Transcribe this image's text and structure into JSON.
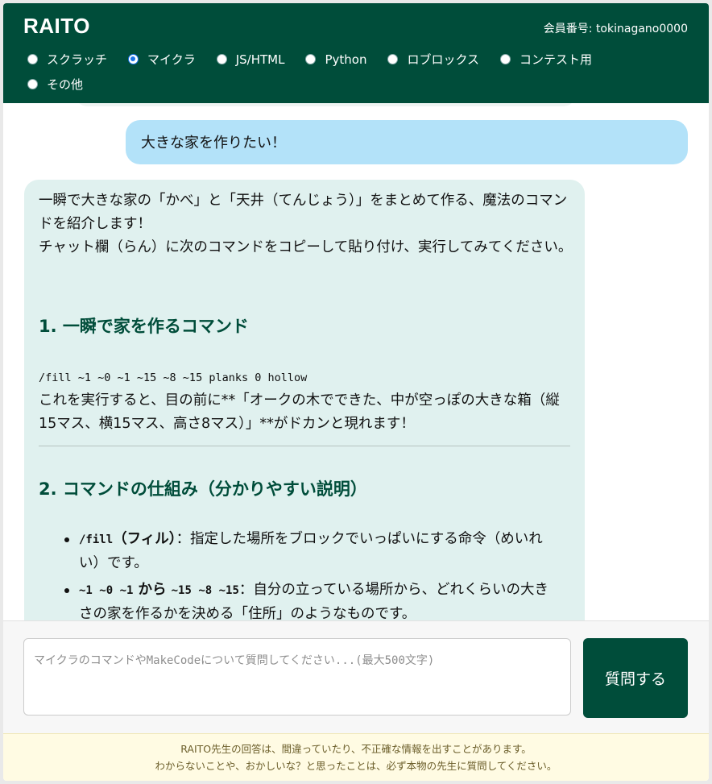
{
  "header": {
    "brand": "RAITO",
    "member_label": "会員番号: tokinagano0000",
    "categories": [
      {
        "label": "スクラッチ",
        "checked": false
      },
      {
        "label": "マイクラ",
        "checked": true
      },
      {
        "label": "JS/HTML",
        "checked": false
      },
      {
        "label": "Python",
        "checked": false
      },
      {
        "label": "ロブロックス",
        "checked": false
      },
      {
        "label": "コンテスト用",
        "checked": false
      },
      {
        "label": "その他",
        "checked": false
      }
    ]
  },
  "chat": {
    "user_message": "大きな家を作りたい！",
    "bot": {
      "intro": "一瞬で大きな家の「かべ」と「天井（てんじょう）」をまとめて作る、魔法のコマンドを紹介します！",
      "instruction": "チャット欄（らん）に次のコマンドをコピーして貼り付け、実行してみてください。",
      "heading1": "1. 一瞬で家を作るコマンド",
      "command": "/fill ~1 ~0 ~1 ~15 ~8 ~15 planks 0 hollow",
      "result": "これを実行すると、目の前に**「オークの木でできた、中が空っぽの大きな箱（縦15マス、横15マス、高さ8マス）」**がドカンと現れます！",
      "heading2": "2. コマンドの仕組み（分かりやすい説明）",
      "bullets": [
        {
          "code": "/fill",
          "term": "（フィル）",
          "text": "：指定した場所をブロックでいっぱいにする命令（めいれい）です。"
        },
        {
          "code": "~1 ~0 ~1",
          "term": " から ",
          "code2": "~15 ~8 ~15",
          "text": "：自分の立っている場所から、どれくらいの大きさの家を作るかを決める「住所」のようなものです。"
        }
      ]
    }
  },
  "input": {
    "placeholder": "マイクラのコマンドやMakeCodeについて質問してください...(最大500文字)",
    "value": "",
    "submit_label": "質問する"
  },
  "footer": {
    "line1": "RAITO先生の回答は、間違っていたり、不正確な情報を出すことがあります。",
    "line2": "わからないことや、おかしいな？と思ったことは、必ず本物の先生に質問してください。"
  },
  "colors": {
    "header_bg": "#004d3a",
    "user_bubble": "#b3e2f9",
    "bot_bubble": "#e0f1ef",
    "heading": "#004d3a",
    "footer_bg": "#fffbe3"
  }
}
